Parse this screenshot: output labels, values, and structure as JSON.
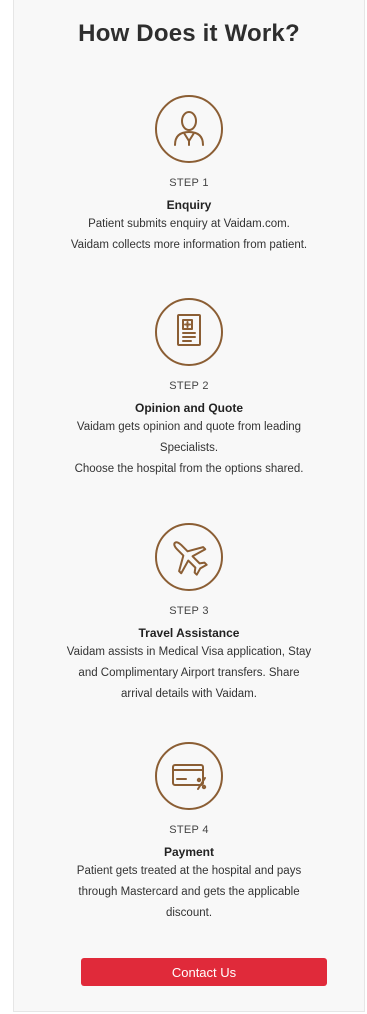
{
  "title": "How Does it Work?",
  "steps": [
    {
      "number": "STEP 1",
      "title": "Enquiry",
      "lines": [
        "Patient submits enquiry at Vaidam.com.",
        "Vaidam collects more information from patient."
      ],
      "icon": "doctor-icon"
    },
    {
      "number": "STEP 2",
      "title": "Opinion and Quote",
      "lines": [
        "Vaidam gets opinion and quote from leading",
        "Specialists.",
        "Choose the hospital from the options shared."
      ],
      "icon": "medical-report-icon"
    },
    {
      "number": "STEP 3",
      "title": "Travel Assistance",
      "lines": [
        "Vaidam assists in Medical Visa application, Stay",
        "and Complimentary Airport transfers. Share",
        "arrival details with Vaidam."
      ],
      "icon": "airplane-icon"
    },
    {
      "number": "STEP 4",
      "title": "Payment",
      "lines": [
        "Patient gets treated at the hospital and pays",
        "through Mastercard and gets the applicable",
        "discount."
      ],
      "icon": "card-discount-icon"
    }
  ],
  "cta": {
    "label": "Contact Us"
  },
  "colors": {
    "icon_brown": "#8b5e34",
    "cta_red": "#e02a3a"
  }
}
